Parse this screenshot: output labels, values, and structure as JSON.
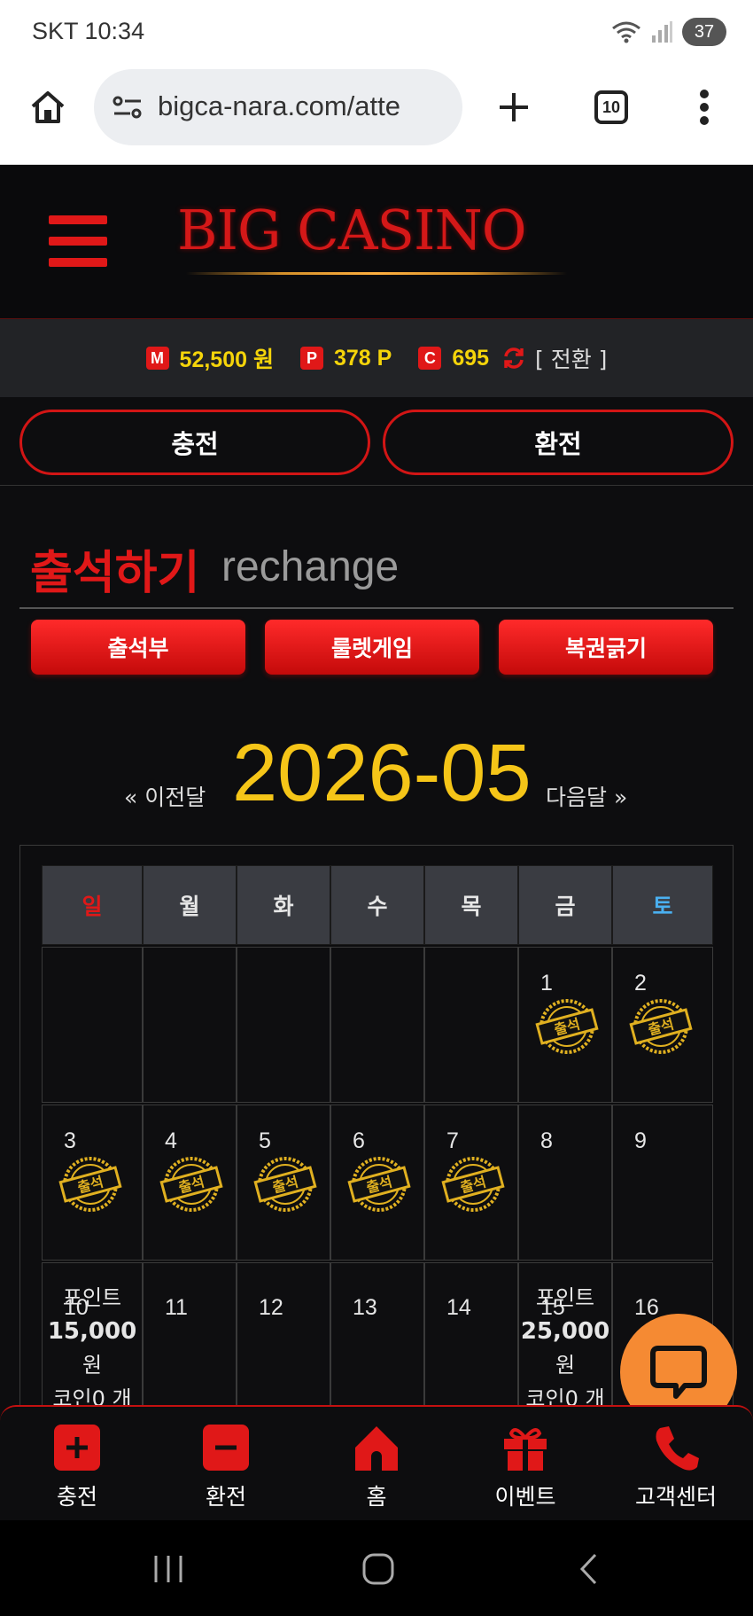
{
  "statusbar": {
    "carrier_time": "SKT 10:34",
    "battery": "37"
  },
  "browser": {
    "url": "bigca-nara.com/atte",
    "tab_count": "10"
  },
  "site": {
    "logo": "BIG CASINO",
    "balance": {
      "money_badge": "M",
      "money": "52,500 원",
      "point_badge": "P",
      "point": "378 P",
      "coin_badge": "C",
      "coin": "695",
      "convert": "[ 전환 ]"
    },
    "actions": {
      "charge": "충전",
      "exchange": "환전"
    },
    "section": {
      "title": "출석하기",
      "subtitle": "rechange"
    },
    "subtabs": [
      "출석부",
      "룰렛게임",
      "복권긁기"
    ],
    "calendar": {
      "prev": "« 이전달",
      "month": "2026-05",
      "next": "다음달 »",
      "weekdays": [
        "일",
        "월",
        "화",
        "수",
        "목",
        "금",
        "토"
      ],
      "rows": [
        [
          "",
          "",
          "",
          "",
          "",
          "1",
          "2"
        ],
        [
          "3",
          "4",
          "5",
          "6",
          "7",
          "8",
          "9"
        ],
        [
          "10",
          "11",
          "12",
          "13",
          "14",
          "15",
          "16"
        ]
      ],
      "stamp_text": "출석",
      "rewards": {
        "r10": {
          "line1": "포인트",
          "amount": "15,000",
          "unit": "원",
          "coin": "코인0 개"
        },
        "r15": {
          "line1": "포인트",
          "amount": "25,000",
          "unit": "원",
          "coin": "코인0 개"
        }
      }
    },
    "bottom_nav": [
      "충전",
      "환전",
      "홈",
      "이벤트",
      "고객센터"
    ]
  },
  "colors": {
    "accent": "#e01818",
    "gold": "#f5c518",
    "chat": "#f58a33",
    "saturday": "#4ab0f0"
  }
}
